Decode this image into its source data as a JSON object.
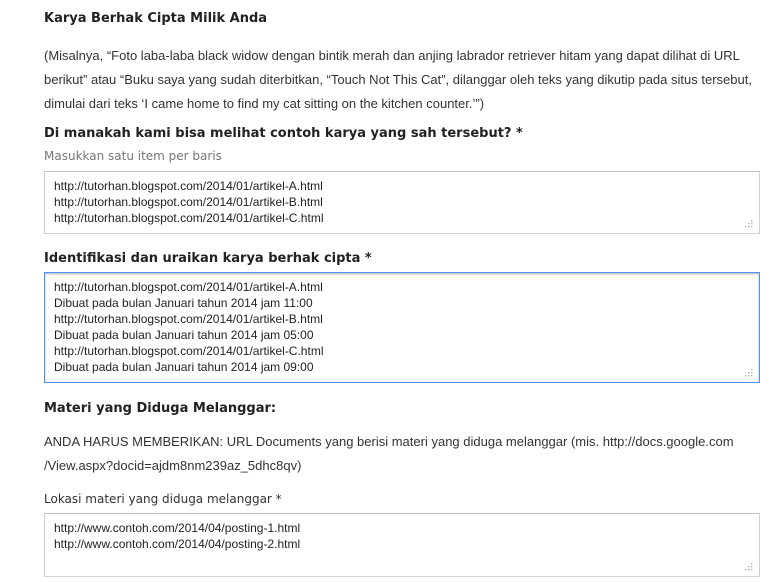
{
  "section_title": "Karya Berhak Cipta Milik Anda",
  "example_paragraph": [
    "(Misalnya, “Foto laba-laba black widow dengan bintik merah dan anjing labrador retriever hitam yang dapat dilihat di URL",
    "berikut” atau “Buku saya yang sudah diterbitkan, “Touch Not This Cat”, dilanggar oleh teks yang dikutip pada situs tersebut,",
    "dimulai dari teks ‘I came home to find my cat sitting on the kitchen counter.’”)"
  ],
  "where_question": {
    "label": "Di manakah kami bisa melihat contoh karya yang sah tersebut? *",
    "hint": "Masukkan satu item per baris",
    "lines": [
      "http://tutorhan.blogspot.com/2014/01/artikel-A.html",
      "http://tutorhan.blogspot.com/2014/01/artikel-B.html",
      "http://tutorhan.blogspot.com/2014/01/artikel-C.html"
    ]
  },
  "identify_question": {
    "label": "Identifikasi dan uraikan karya berhak cipta *",
    "lines": [
      "http://tutorhan.blogspot.com/2014/01/artikel-A.html",
      "Dibuat pada bulan Januari tahun 2014 jam 11:00",
      "http://tutorhan.blogspot.com/2014/01/artikel-B.html",
      "Dibuat pada bulan Januari tahun 2014 jam 05:00",
      "http://tutorhan.blogspot.com/2014/01/artikel-C.html",
      "Dibuat pada bulan Januari tahun 2014 jam 09:00"
    ]
  },
  "infringing_section": {
    "title": "Materi yang Diduga Melanggar:",
    "notice": [
      "ANDA HARUS MEMBERIKAN: URL Documents yang berisi materi yang diduga melanggar (mis. http://docs.google.com",
      "/View.aspx?docid=ajdm8nm239az_5dhc8qv)"
    ]
  },
  "location_question": {
    "label": "Lokasi materi yang diduga melanggar *",
    "lines": [
      "http://www.contoh.com/2014/04/posting-1.html",
      "http://www.contoh.com/2014/04/posting-2.html"
    ]
  },
  "colors": {
    "focus_border": "#4d90fe",
    "field_border": "#d2d2d2",
    "text": "#222222",
    "hint": "#777777"
  },
  "icons": {
    "resize_grip": "resize-grip-icon"
  }
}
